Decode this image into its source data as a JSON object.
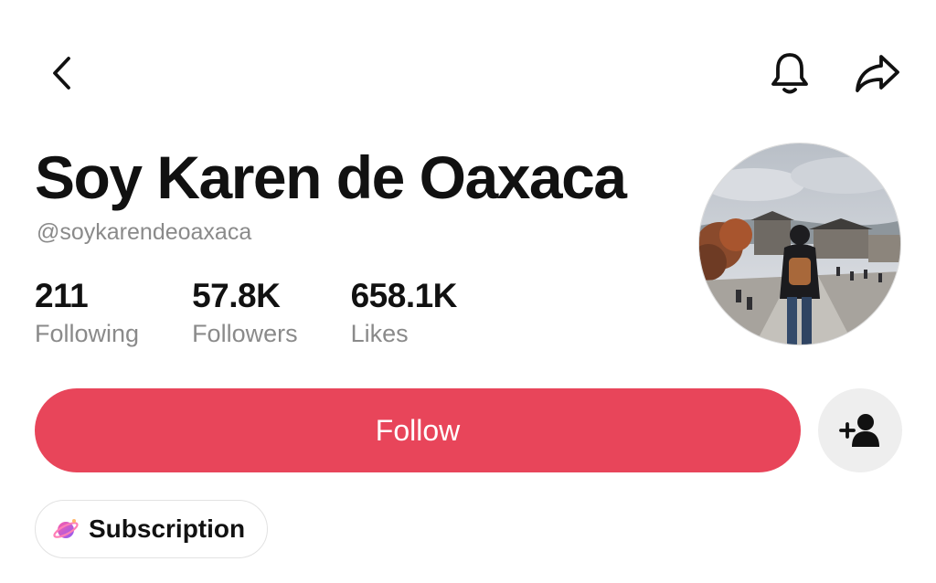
{
  "header": {
    "back_icon": "chevron-left-icon",
    "bell_icon": "bell-icon",
    "share_icon": "share-arrow-icon"
  },
  "profile": {
    "display_name": "Soy Karen de Oaxaca",
    "handle": "@soykarendeoaxaca",
    "avatar_description": "person with backpack walking on a city street"
  },
  "stats": [
    {
      "value": "211",
      "label": "Following"
    },
    {
      "value": "57.8K",
      "label": "Followers"
    },
    {
      "value": "658.1K",
      "label": "Likes"
    }
  ],
  "actions": {
    "follow_label": "Follow",
    "add_friend_icon": "add-user-icon",
    "subscription_label": "Subscription",
    "subscription_icon": "planet-icon"
  },
  "colors": {
    "follow_button": "#e8455a",
    "secondary_text": "#8a8a8a",
    "add_friend_bg": "#eeeeee"
  }
}
